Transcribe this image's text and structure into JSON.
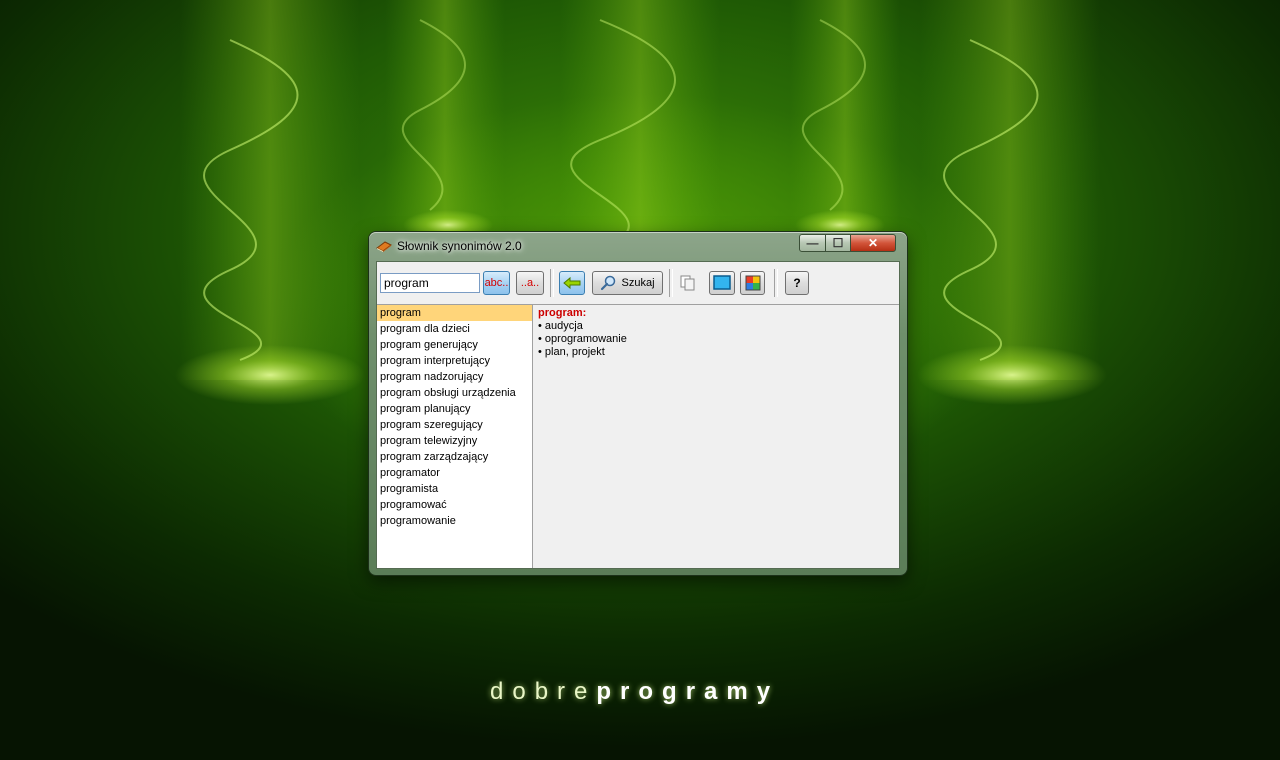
{
  "desktop": {
    "logo_light": "dobre",
    "logo_bold": "programy"
  },
  "window": {
    "title": "Słownik synonimów 2.0",
    "icon": "book-icon",
    "caption": {
      "minimize": "—",
      "maximize": "☐",
      "close": "✕"
    }
  },
  "toolbar": {
    "search_value": "program",
    "btn_prefix_label": "abc..",
    "btn_suffix_label": "..a..",
    "btn_back_icon": "arrow-left-icon",
    "btn_search_label": "Szukaj",
    "btn_search_icon": "magnifier-icon",
    "btn_copy_icon": "copy-icon",
    "btn_window_icon": "window-icon",
    "btn_colors_icon": "color-palette-icon",
    "btn_help_label": "?"
  },
  "wordlist": {
    "items": [
      "program",
      "program dla dzieci",
      "program generujący",
      "program interpretujący",
      "program nadzorujący",
      "program obsługi urządzenia",
      "program planujący",
      "program szeregujący",
      "program telewizyjny",
      "program zarządzający",
      "programator",
      "programista",
      "programować",
      "programowanie"
    ],
    "selected_index": 0
  },
  "details": {
    "headword": "program:",
    "synonyms": [
      "audycja",
      "oprogramowanie",
      "plan, projekt"
    ]
  },
  "colors": {
    "selection": "#ffd57a",
    "headword": "#cc0000",
    "desktop_green": "#3e8a07"
  }
}
